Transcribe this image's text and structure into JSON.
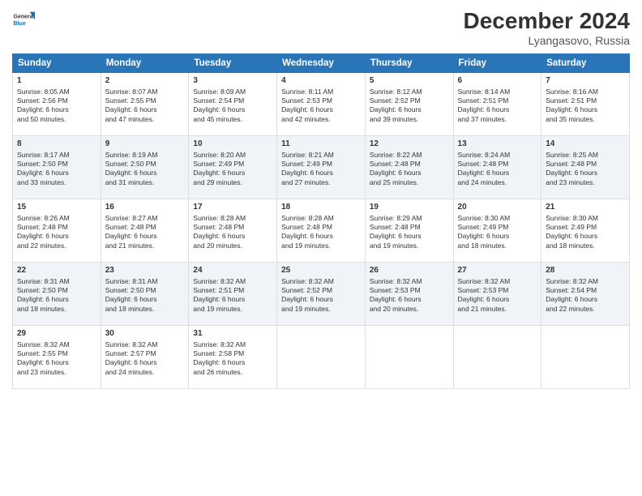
{
  "header": {
    "logo_line1": "General",
    "logo_line2": "Blue",
    "month": "December 2024",
    "location": "Lyangasovo, Russia"
  },
  "weekdays": [
    "Sunday",
    "Monday",
    "Tuesday",
    "Wednesday",
    "Thursday",
    "Friday",
    "Saturday"
  ],
  "weeks": [
    [
      {
        "day": "1",
        "info": "Sunrise: 8:05 AM\nSunset: 2:56 PM\nDaylight: 6 hours\nand 50 minutes."
      },
      {
        "day": "2",
        "info": "Sunrise: 8:07 AM\nSunset: 2:55 PM\nDaylight: 6 hours\nand 47 minutes."
      },
      {
        "day": "3",
        "info": "Sunrise: 8:09 AM\nSunset: 2:54 PM\nDaylight: 6 hours\nand 45 minutes."
      },
      {
        "day": "4",
        "info": "Sunrise: 8:11 AM\nSunset: 2:53 PM\nDaylight: 6 hours\nand 42 minutes."
      },
      {
        "day": "5",
        "info": "Sunrise: 8:12 AM\nSunset: 2:52 PM\nDaylight: 6 hours\nand 39 minutes."
      },
      {
        "day": "6",
        "info": "Sunrise: 8:14 AM\nSunset: 2:51 PM\nDaylight: 6 hours\nand 37 minutes."
      },
      {
        "day": "7",
        "info": "Sunrise: 8:16 AM\nSunset: 2:51 PM\nDaylight: 6 hours\nand 35 minutes."
      }
    ],
    [
      {
        "day": "8",
        "info": "Sunrise: 8:17 AM\nSunset: 2:50 PM\nDaylight: 6 hours\nand 33 minutes."
      },
      {
        "day": "9",
        "info": "Sunrise: 8:19 AM\nSunset: 2:50 PM\nDaylight: 6 hours\nand 31 minutes."
      },
      {
        "day": "10",
        "info": "Sunrise: 8:20 AM\nSunset: 2:49 PM\nDaylight: 6 hours\nand 29 minutes."
      },
      {
        "day": "11",
        "info": "Sunrise: 8:21 AM\nSunset: 2:49 PM\nDaylight: 6 hours\nand 27 minutes."
      },
      {
        "day": "12",
        "info": "Sunrise: 8:22 AM\nSunset: 2:48 PM\nDaylight: 6 hours\nand 25 minutes."
      },
      {
        "day": "13",
        "info": "Sunrise: 8:24 AM\nSunset: 2:48 PM\nDaylight: 6 hours\nand 24 minutes."
      },
      {
        "day": "14",
        "info": "Sunrise: 8:25 AM\nSunset: 2:48 PM\nDaylight: 6 hours\nand 23 minutes."
      }
    ],
    [
      {
        "day": "15",
        "info": "Sunrise: 8:26 AM\nSunset: 2:48 PM\nDaylight: 6 hours\nand 22 minutes."
      },
      {
        "day": "16",
        "info": "Sunrise: 8:27 AM\nSunset: 2:48 PM\nDaylight: 6 hours\nand 21 minutes."
      },
      {
        "day": "17",
        "info": "Sunrise: 8:28 AM\nSunset: 2:48 PM\nDaylight: 6 hours\nand 20 minutes."
      },
      {
        "day": "18",
        "info": "Sunrise: 8:28 AM\nSunset: 2:48 PM\nDaylight: 6 hours\nand 19 minutes."
      },
      {
        "day": "19",
        "info": "Sunrise: 8:29 AM\nSunset: 2:48 PM\nDaylight: 6 hours\nand 19 minutes."
      },
      {
        "day": "20",
        "info": "Sunrise: 8:30 AM\nSunset: 2:49 PM\nDaylight: 6 hours\nand 18 minutes."
      },
      {
        "day": "21",
        "info": "Sunrise: 8:30 AM\nSunset: 2:49 PM\nDaylight: 6 hours\nand 18 minutes."
      }
    ],
    [
      {
        "day": "22",
        "info": "Sunrise: 8:31 AM\nSunset: 2:50 PM\nDaylight: 6 hours\nand 18 minutes."
      },
      {
        "day": "23",
        "info": "Sunrise: 8:31 AM\nSunset: 2:50 PM\nDaylight: 6 hours\nand 18 minutes."
      },
      {
        "day": "24",
        "info": "Sunrise: 8:32 AM\nSunset: 2:51 PM\nDaylight: 6 hours\nand 19 minutes."
      },
      {
        "day": "25",
        "info": "Sunrise: 8:32 AM\nSunset: 2:52 PM\nDaylight: 6 hours\nand 19 minutes."
      },
      {
        "day": "26",
        "info": "Sunrise: 8:32 AM\nSunset: 2:53 PM\nDaylight: 6 hours\nand 20 minutes."
      },
      {
        "day": "27",
        "info": "Sunrise: 8:32 AM\nSunset: 2:53 PM\nDaylight: 6 hours\nand 21 minutes."
      },
      {
        "day": "28",
        "info": "Sunrise: 8:32 AM\nSunset: 2:54 PM\nDaylight: 6 hours\nand 22 minutes."
      }
    ],
    [
      {
        "day": "29",
        "info": "Sunrise: 8:32 AM\nSunset: 2:55 PM\nDaylight: 6 hours\nand 23 minutes."
      },
      {
        "day": "30",
        "info": "Sunrise: 8:32 AM\nSunset: 2:57 PM\nDaylight: 6 hours\nand 24 minutes."
      },
      {
        "day": "31",
        "info": "Sunrise: 8:32 AM\nSunset: 2:58 PM\nDaylight: 6 hours\nand 26 minutes."
      },
      null,
      null,
      null,
      null
    ]
  ]
}
